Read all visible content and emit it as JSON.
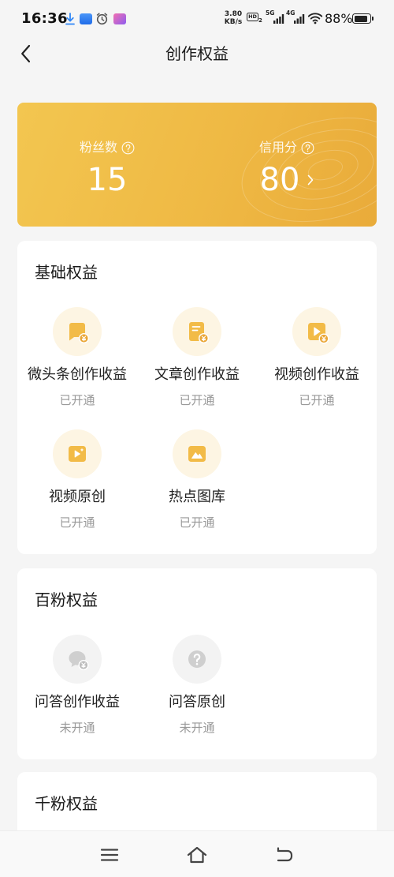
{
  "status_bar": {
    "time": "16:36",
    "net_speed": "3.80",
    "net_speed_unit": "KB/s",
    "hd_label": "HD",
    "hd_index": "2",
    "network_5g": "5G",
    "network_4g": "4G",
    "battery_text": "88%",
    "battery_level": 0.88,
    "notification_icons": [
      "download-icon",
      "app-notification-icon",
      "alarm-icon",
      "app-notification-icon"
    ]
  },
  "header": {
    "title": "创作权益",
    "back_icon": "back-chevron-icon"
  },
  "stats": {
    "fans_label": "粉丝数",
    "fans_value": "15",
    "credit_label": "信用分",
    "credit_value": "80",
    "help_icon": "help-icon",
    "credit_arrow_icon": "chevron-right-icon"
  },
  "sections": [
    {
      "title": "基础权益",
      "items": [
        {
          "name": "微头条创作收益",
          "status": "已开通",
          "enabled": true,
          "icon": "micro-post-income-icon"
        },
        {
          "name": "文章创作收益",
          "status": "已开通",
          "enabled": true,
          "icon": "article-income-icon"
        },
        {
          "name": "视频创作收益",
          "status": "已开通",
          "enabled": true,
          "icon": "video-income-icon"
        },
        {
          "name": "视频原创",
          "status": "已开通",
          "enabled": true,
          "icon": "video-original-icon"
        },
        {
          "name": "热点图库",
          "status": "已开通",
          "enabled": true,
          "icon": "image-library-icon"
        }
      ]
    },
    {
      "title": "百粉权益",
      "items": [
        {
          "name": "问答创作收益",
          "status": "未开通",
          "enabled": false,
          "icon": "qa-income-icon"
        },
        {
          "name": "问答原创",
          "status": "未开通",
          "enabled": false,
          "icon": "qa-original-icon"
        }
      ]
    },
    {
      "title": "千粉权益",
      "items": []
    }
  ],
  "bottom_nav": [
    {
      "icon": "menu-icon"
    },
    {
      "icon": "home-icon"
    },
    {
      "icon": "back-icon"
    }
  ],
  "colors": {
    "gold_start": "#f3c650",
    "gold_end": "#e9ab3a",
    "icon_gold": "#f2bb47",
    "icon_gray": "#cfcfcf",
    "page_bg": "#f5f5f5",
    "status_text": "#999999"
  }
}
